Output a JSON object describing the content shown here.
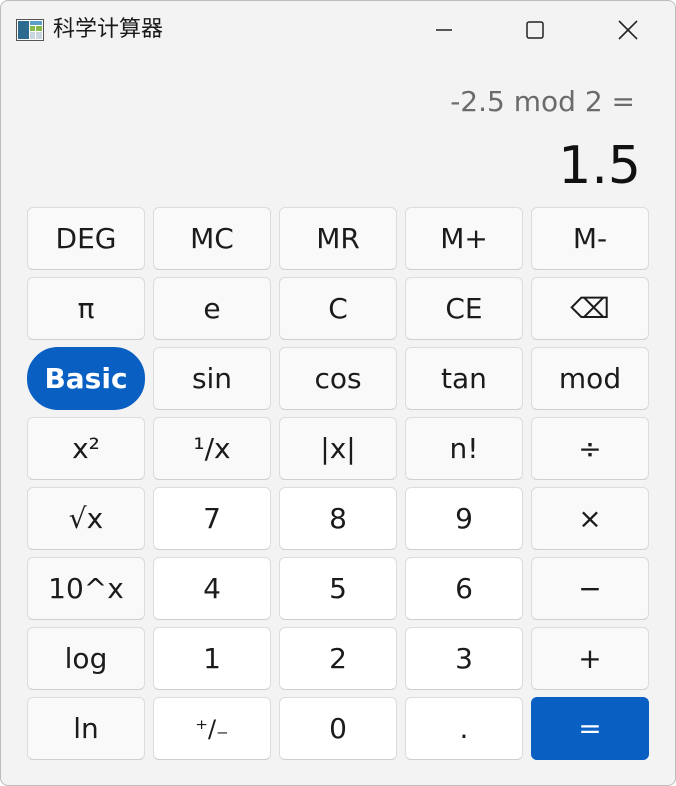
{
  "window": {
    "title": "科学计算器",
    "icon": "calculator-app-icon",
    "controls": {
      "minimize_icon": "minimize-icon",
      "maximize_icon": "maximize-icon",
      "close_icon": "close-icon"
    }
  },
  "display": {
    "expression": "-2.5 mod 2 =",
    "result": "1.5"
  },
  "colors": {
    "accent": "#0a5fc2",
    "background": "#f3f3f3",
    "key_background": "#f9f9f9",
    "digit_key_background": "#ffffff"
  },
  "keypad": {
    "rows": [
      [
        "DEG",
        "MC",
        "MR",
        "M+",
        "M-"
      ],
      [
        "π",
        "e",
        "C",
        "CE",
        "⌫"
      ],
      [
        "Basic",
        "sin",
        "cos",
        "tan",
        "mod"
      ],
      [
        "x²",
        "¹/x",
        "|x|",
        "n!",
        "÷"
      ],
      [
        "√x",
        "7",
        "8",
        "9",
        "×"
      ],
      [
        "10^x",
        "4",
        "5",
        "6",
        "−"
      ],
      [
        "log",
        "1",
        "2",
        "3",
        "+"
      ],
      [
        "ln",
        "⁺/₋",
        "0",
        ".",
        "="
      ]
    ],
    "active_mode": "Basic"
  }
}
